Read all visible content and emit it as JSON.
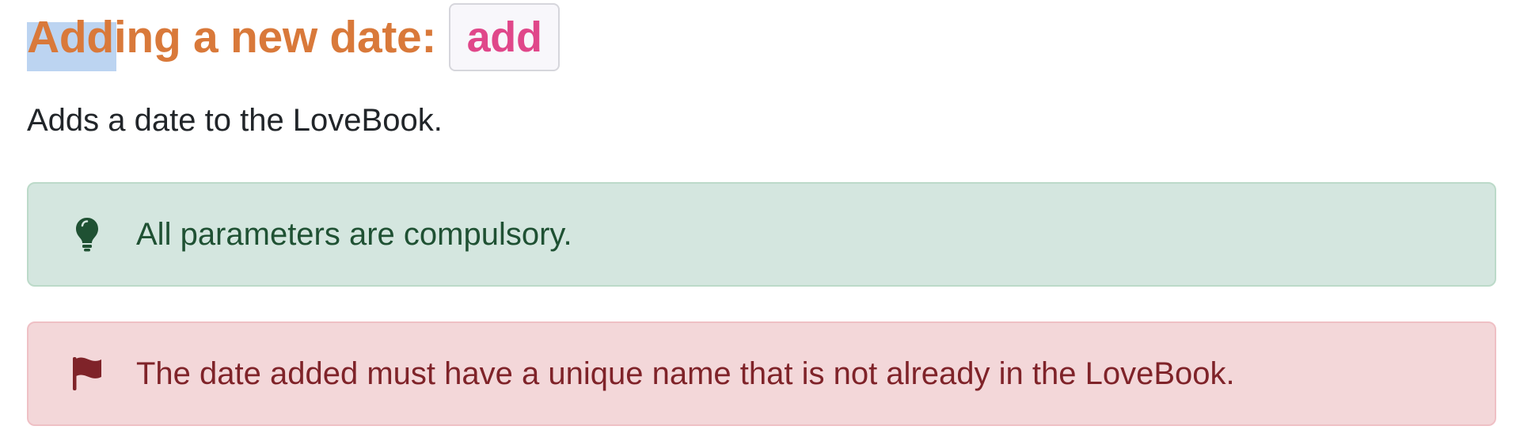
{
  "heading": {
    "title": "Adding a new date:",
    "command": "add"
  },
  "description": "Adds a date to the LoveBook.",
  "callouts": [
    {
      "type": "tip",
      "icon": "lightbulb-icon",
      "text": "All parameters are compulsory.",
      "color": "#1f5133",
      "background": "#d4e6df"
    },
    {
      "type": "warning",
      "icon": "flag-icon",
      "text": "The date added must have a unique name that is not already in the LoveBook.",
      "color": "#7f2329",
      "background": "#f3d7d9"
    }
  ],
  "colors": {
    "heading": "#d9793a",
    "command": "#e0478a",
    "selection": "#bcd4f1"
  }
}
